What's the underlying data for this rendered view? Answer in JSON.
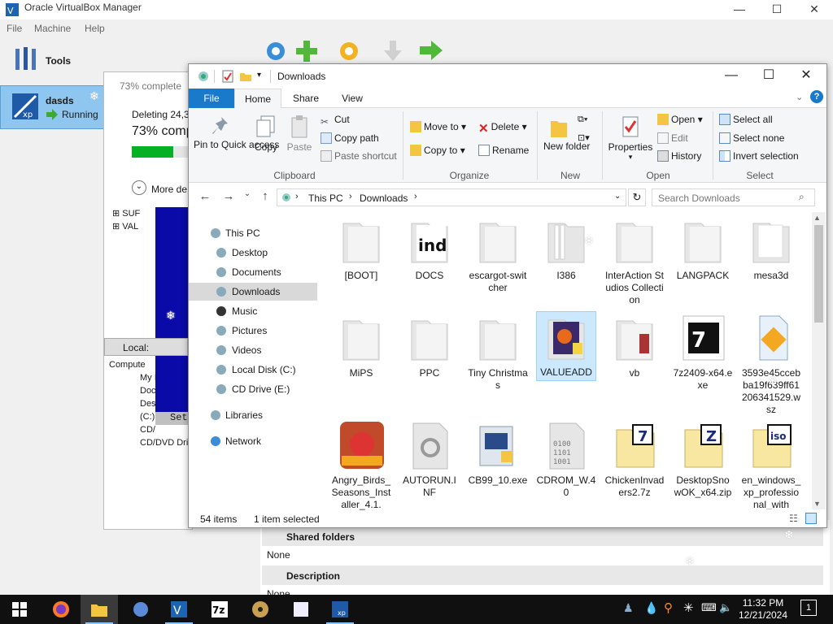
{
  "vbox": {
    "title": "Oracle VirtualBox Manager",
    "menu": [
      "File",
      "Machine",
      "Help"
    ],
    "tools_label": "Tools",
    "vm_name": "dasds",
    "vm_state": "Running",
    "shared_folders_label": "Shared folders",
    "shared_folders_value": "None",
    "description_label": "Description",
    "description_value": "None"
  },
  "progress": {
    "title": "73% complete",
    "subtitle": "Deleting 24,34",
    "percent_text": "73% comp",
    "fraction": 0.73,
    "more_details": "More de",
    "local_tab": "Local:",
    "tree": [
      "SUF",
      "VAL",
      "Compute",
      "My I",
      "Doc",
      "Des",
      "(C:)",
      "CD/",
      "CD/DVD Dri"
    ],
    "setup_text": "Set"
  },
  "explorer": {
    "title": "Downloads",
    "tabs": [
      "File",
      "Home",
      "Share",
      "View"
    ],
    "clipboard": {
      "pin": "Pin to Quick access",
      "copy": "Copy",
      "paste": "Paste",
      "cut": "Cut",
      "copy_path": "Copy path",
      "paste_shortcut": "Paste shortcut",
      "group": "Clipboard"
    },
    "organize": {
      "move_to": "Move to",
      "copy_to": "Copy to",
      "delete": "Delete",
      "rename": "Rename",
      "group": "Organize"
    },
    "new": {
      "new_folder": "New folder",
      "group": "New"
    },
    "open": {
      "properties": "Properties",
      "open": "Open",
      "edit": "Edit",
      "history": "History",
      "group": "Open"
    },
    "select": {
      "select_all": "Select all",
      "select_none": "Select none",
      "invert": "Invert selection",
      "group": "Select"
    },
    "breadcrumb": [
      "This PC",
      "Downloads"
    ],
    "search_placeholder": "Search Downloads",
    "nav": [
      "This PC",
      "Desktop",
      "Documents",
      "Downloads",
      "Music",
      "Pictures",
      "Videos",
      "Local Disk (C:)",
      "CD Drive (E:)",
      "Libraries",
      "Network"
    ],
    "files_row1": [
      "[BOOT]",
      "DOCS",
      "escargot-switcher",
      "I386",
      "InterAction Studios Collection",
      "LANGPACK",
      "mesa3d"
    ],
    "files_row2": [
      "MiPS",
      "PPC",
      "Tiny Christmas",
      "VALUEADD",
      "vb",
      "7z2409-x64.exe",
      "3593e45ccebba19f639ff61206341529.wsz"
    ],
    "files_row3": [
      "Angry_Birds_Seasons_Installer_4.1.",
      "AUTORUN.INF",
      "CB99_10.exe",
      "CDROM_W.40",
      "ChickenInvaders2.7z",
      "DesktopSnowOK_x64.zip",
      "en_windows_xp_professional_with"
    ],
    "status_count": "54 items",
    "status_selected": "1 item selected"
  },
  "taskbar": {
    "time": "11:32 PM",
    "date": "12/21/2024"
  },
  "colors": {
    "accent": "#1979ca",
    "progress_fill": "#06b025",
    "selected_bg": "#cce8ff",
    "vm_selected": "#8fc6f0"
  }
}
